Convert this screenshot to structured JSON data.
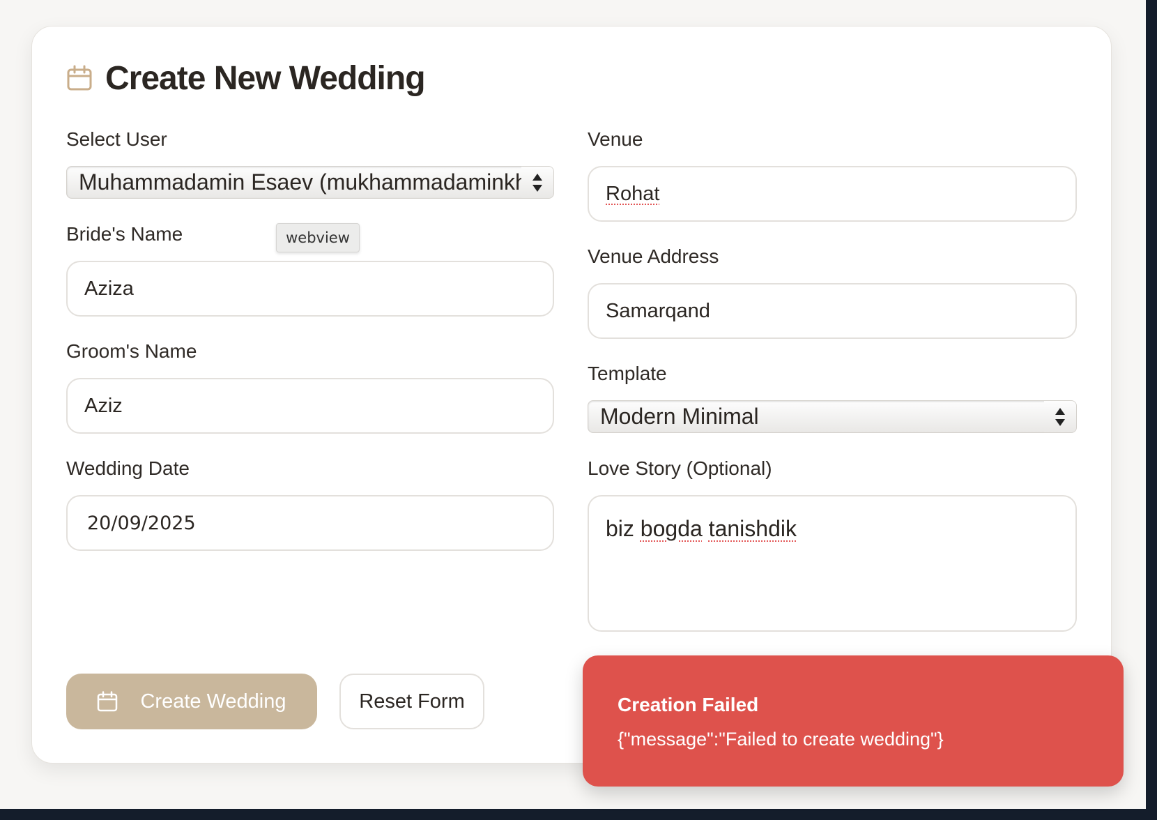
{
  "page": {
    "title": "Create New Wedding",
    "title_icon": "calendar-icon",
    "accent_color": "#c9b79c",
    "error_color": "#de524c"
  },
  "form": {
    "select_user": {
      "label": "Select User",
      "value": "Muhammadamin Esaev (mukhammadaminkhoja"
    },
    "bride_name": {
      "label": "Bride's Name",
      "value": "Aziza"
    },
    "groom_name": {
      "label": "Groom's Name",
      "value": "Aziz"
    },
    "wedding_date": {
      "label": "Wedding Date",
      "value": "20/09/2025"
    },
    "venue": {
      "label": "Venue",
      "value": "Rohat"
    },
    "venue_address": {
      "label": "Venue Address",
      "value": "Samarqand"
    },
    "template": {
      "label": "Template",
      "value": "Modern Minimal"
    },
    "love_story": {
      "label": "Love Story (Optional)",
      "value_word1": "biz",
      "value_word2": "bogda",
      "value_word3": "tanishdik"
    }
  },
  "tooltip": {
    "text": "webview"
  },
  "actions": {
    "create_label": "Create Wedding",
    "create_icon": "calendar-icon",
    "reset_label": "Reset Form"
  },
  "toast": {
    "title": "Creation Failed",
    "message": "{\"message\":\"Failed to create wedding\"}"
  }
}
